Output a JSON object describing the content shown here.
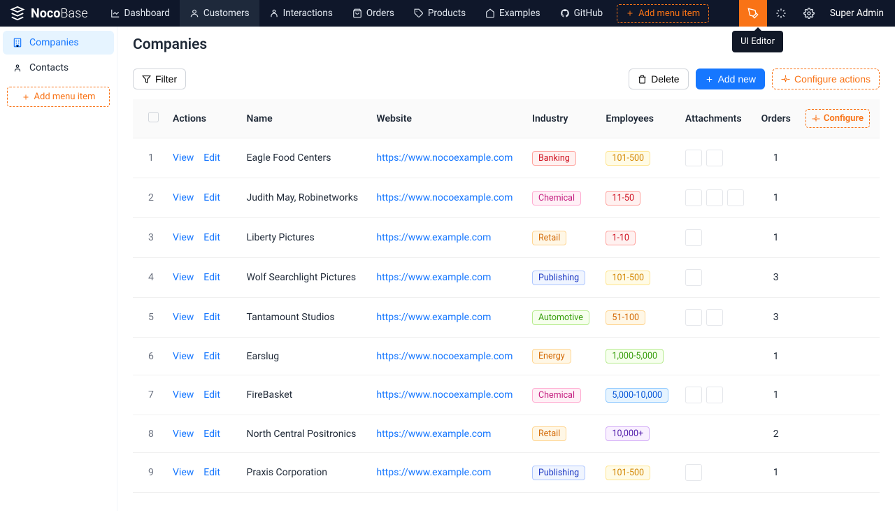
{
  "brand": {
    "name1": "Noco",
    "name2": "Base"
  },
  "nav": [
    {
      "label": "Dashboard",
      "icon": "chart"
    },
    {
      "label": "Customers",
      "icon": "user",
      "active": true
    },
    {
      "label": "Interactions",
      "icon": "person"
    },
    {
      "label": "Orders",
      "icon": "cart"
    },
    {
      "label": "Products",
      "icon": "tag"
    },
    {
      "label": "Examples",
      "icon": "home"
    },
    {
      "label": "GitHub",
      "icon": "github"
    }
  ],
  "add_menu_item": "Add menu item",
  "user": "Super Admin",
  "tooltip": "UI Editor",
  "sidebar": [
    {
      "label": "Companies",
      "icon": "building",
      "active": true
    },
    {
      "label": "Contacts",
      "icon": "contact"
    }
  ],
  "page_title": "Companies",
  "toolbar": {
    "filter": "Filter",
    "delete": "Delete",
    "add_new": "Add new",
    "configure": "Configure actions",
    "configure_col": "Configure"
  },
  "columns": [
    "",
    "Actions",
    "Name",
    "Website",
    "Industry",
    "Employees",
    "Attachments",
    "Orders"
  ],
  "actions": {
    "view": "View",
    "edit": "Edit"
  },
  "rows": [
    {
      "n": "1",
      "name": "Eagle Food Centers",
      "website": "https://www.nocoexample.com",
      "industry": "Banking",
      "industry_class": "tag-red",
      "employees": "101-500",
      "emp_class": "tag-gold",
      "attachments": [
        "#b58863",
        "#d4a84b"
      ],
      "orders": "1"
    },
    {
      "n": "2",
      "name": "Judith May, Robinetworks",
      "website": "https://www.nocoexample.com",
      "industry": "Chemical",
      "industry_class": "tag-pink",
      "employees": "11-50",
      "emp_class": "tag-red",
      "attachments": [
        "#d4a84b",
        "#9c5b2e",
        "#b07d4f"
      ],
      "orders": "1"
    },
    {
      "n": "3",
      "name": "Liberty Pictures",
      "website": "https://www.example.com",
      "industry": "Retail",
      "industry_class": "tag-orange",
      "employees": "1-10",
      "emp_class": "tag-red",
      "attachments": [
        "#b91c1c"
      ],
      "orders": "1"
    },
    {
      "n": "4",
      "name": "Wolf Searchlight Pictures",
      "website": "https://www.example.com",
      "industry": "Publishing",
      "industry_class": "tag-blue",
      "employees": "101-500",
      "emp_class": "tag-gold",
      "attachments": [
        "#8b6f47"
      ],
      "orders": "3"
    },
    {
      "n": "5",
      "name": "Tantamount Studios",
      "website": "https://www.example.com",
      "industry": "Automotive",
      "industry_class": "tag-green",
      "employees": "51-100",
      "emp_class": "tag-orange",
      "attachments": [
        "#6b7a5e",
        "#d4a84b"
      ],
      "orders": "3"
    },
    {
      "n": "6",
      "name": "Earslug",
      "website": "https://www.nocoexample.com",
      "industry": "Energy",
      "industry_class": "tag-orange",
      "employees": "1,000-5,000",
      "emp_class": "tag-green",
      "attachments": [],
      "orders": "1"
    },
    {
      "n": "7",
      "name": "FireBasket",
      "website": "https://www.nocoexample.com",
      "industry": "Chemical",
      "industry_class": "tag-pink",
      "employees": "5,000-10,000",
      "emp_class": "tag-cyan",
      "attachments": [
        "#1e5f3e",
        "#b07d4f"
      ],
      "orders": "1"
    },
    {
      "n": "8",
      "name": "North Central Positronics",
      "website": "https://www.example.com",
      "industry": "Retail",
      "industry_class": "tag-orange",
      "employees": "10,000+",
      "emp_class": "tag-purple",
      "attachments": [],
      "orders": "2"
    },
    {
      "n": "9",
      "name": "Praxis Corporation",
      "website": "https://www.example.com",
      "industry": "Publishing",
      "industry_class": "tag-blue",
      "employees": "101-500",
      "emp_class": "tag-gold",
      "attachments": [
        "#b91c1c"
      ],
      "orders": "1"
    }
  ]
}
